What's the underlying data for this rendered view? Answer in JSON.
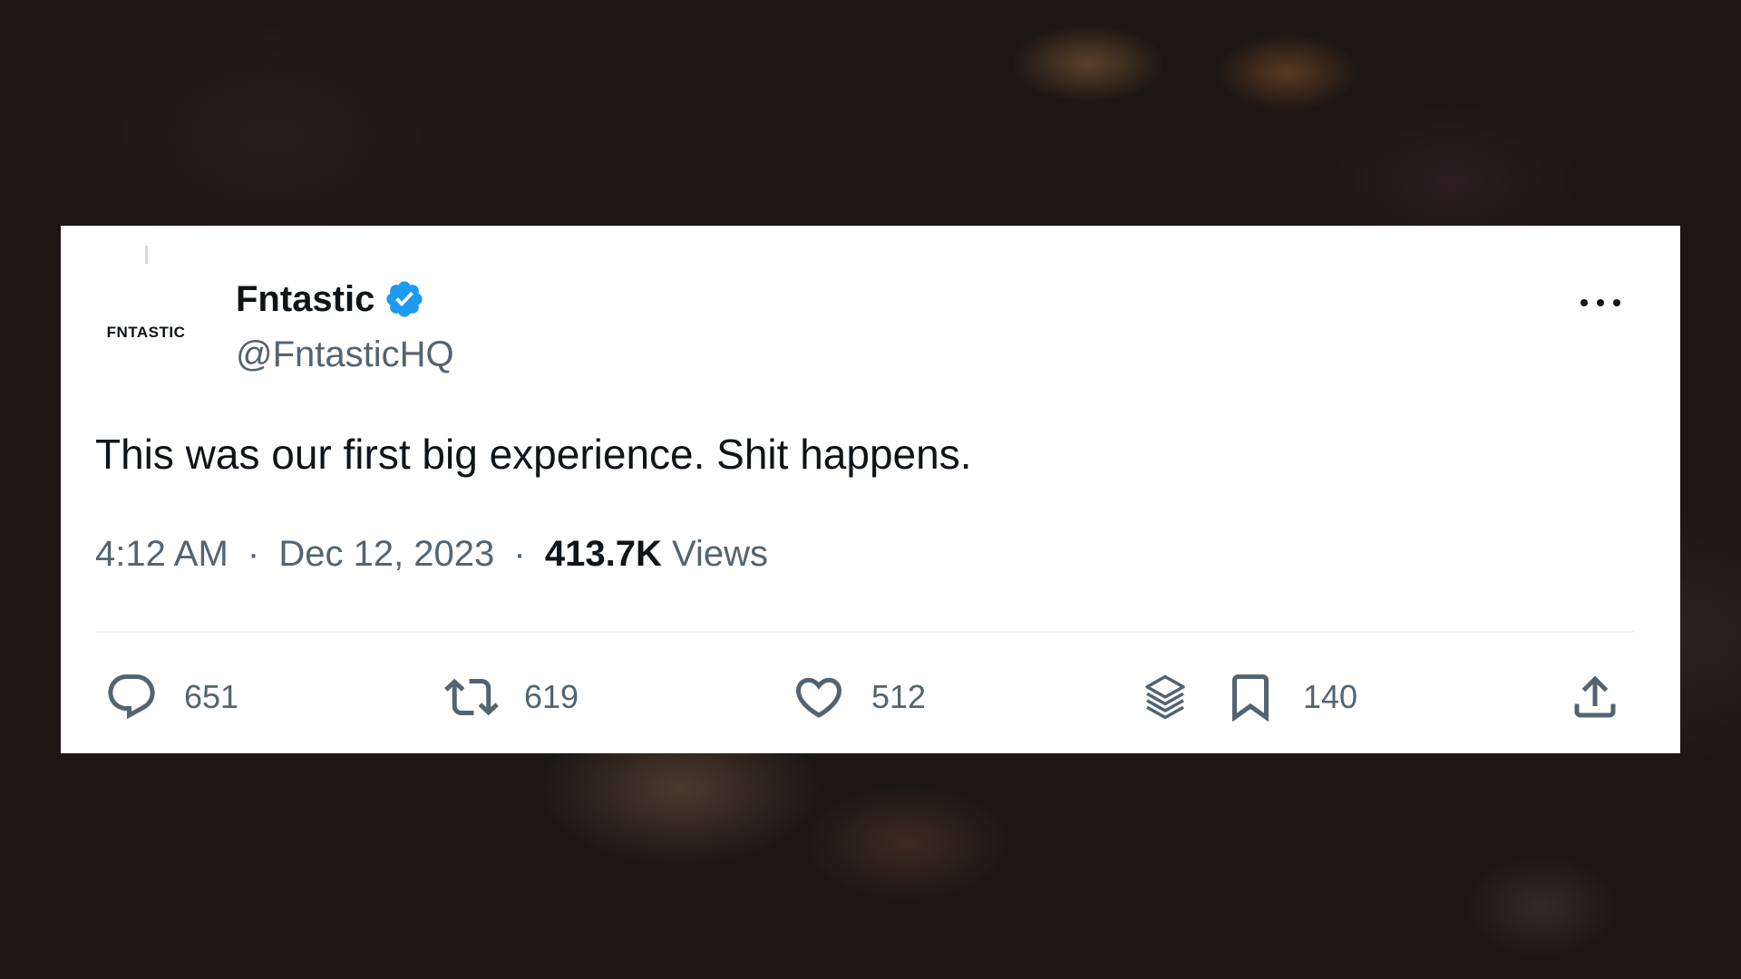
{
  "tweet": {
    "avatar_text": "FNTASTIC",
    "display_name": "Fntastic",
    "handle": "@FntasticHQ",
    "verified": true,
    "text": "This was our first big experience. Shit happens.",
    "time": "4:12 AM",
    "separator": "·",
    "date": "Dec 12, 2023",
    "views_count": "413.7K",
    "views_label": "Views"
  },
  "actions": {
    "replies": "651",
    "retweets": "619",
    "likes": "512",
    "bookmarks": "140"
  },
  "icons": {
    "verified": "verified-badge-icon",
    "more": "more-icon",
    "reply": "reply-icon",
    "retweet": "retweet-icon",
    "like": "heart-icon",
    "layers": "layers-icon",
    "bookmark": "bookmark-icon",
    "share": "share-icon"
  },
  "colors": {
    "accent": "#1d9bf0",
    "text_primary": "#0f1419",
    "text_secondary": "#536471"
  }
}
